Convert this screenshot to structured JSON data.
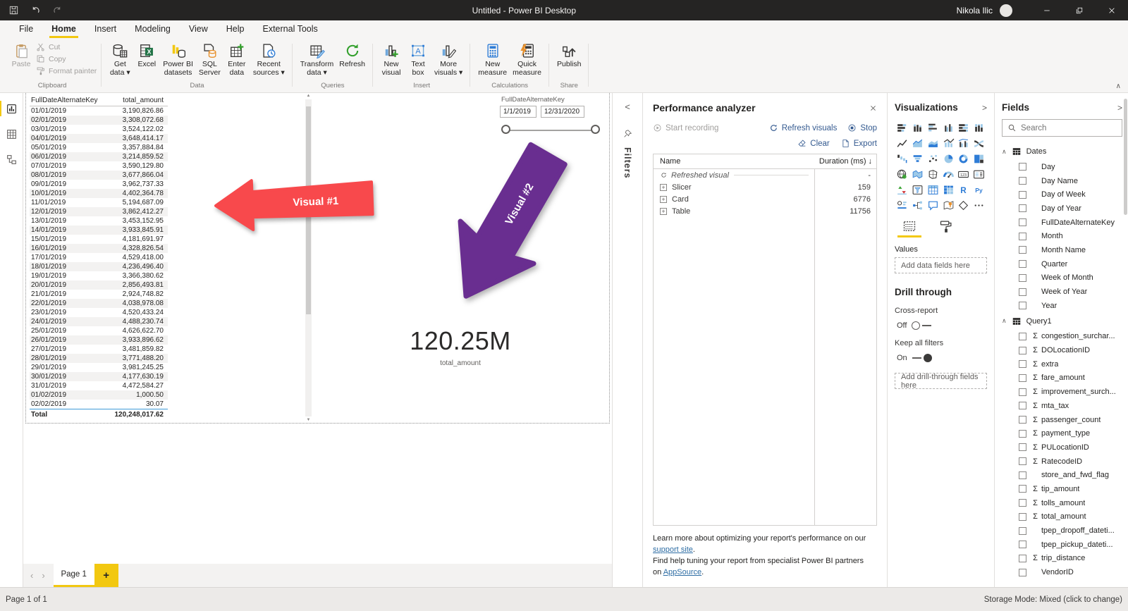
{
  "titlebar": {
    "title": "Untitled - Power BI Desktop",
    "user": "Nikola Ilic"
  },
  "menu": {
    "active": "Home",
    "items": [
      "File",
      "Home",
      "Insert",
      "Modeling",
      "View",
      "Help",
      "External Tools"
    ]
  },
  "ribbon": {
    "collapse_glyph": "∧",
    "groups": [
      {
        "label": "Clipboard",
        "big": [
          {
            "lines": [
              "Paste"
            ],
            "icon": "paste",
            "disabled": true
          }
        ],
        "stack": [
          {
            "label": "Cut",
            "icon": "cut"
          },
          {
            "label": "Copy",
            "icon": "copy"
          },
          {
            "label": "Format painter",
            "icon": "painter"
          }
        ]
      },
      {
        "label": "Data",
        "big": [
          {
            "lines": [
              "Get",
              "data"
            ],
            "icon": "getdata",
            "caret": true
          },
          {
            "lines": [
              "Excel"
            ],
            "icon": "excel"
          },
          {
            "lines": [
              "Power BI",
              "datasets"
            ],
            "icon": "pbidb"
          },
          {
            "lines": [
              "SQL",
              "Server"
            ],
            "icon": "sqldoc"
          },
          {
            "lines": [
              "Enter",
              "data"
            ],
            "icon": "entergrid"
          },
          {
            "lines": [
              "Recent",
              "sources"
            ],
            "icon": "recentdoc",
            "caret": true
          }
        ]
      },
      {
        "label": "Queries",
        "big": [
          {
            "lines": [
              "Transform",
              "data"
            ],
            "icon": "transform",
            "caret": true
          },
          {
            "lines": [
              "Refresh"
            ],
            "icon": "refreshG"
          }
        ]
      },
      {
        "label": "Insert",
        "big": [
          {
            "lines": [
              "New",
              "visual"
            ],
            "icon": "newvis"
          },
          {
            "lines": [
              "Text",
              "box"
            ],
            "icon": "textA"
          },
          {
            "lines": [
              "More",
              "visuals"
            ],
            "icon": "morevis",
            "caret": true
          }
        ]
      },
      {
        "label": "Calculations",
        "big": [
          {
            "lines": [
              "New",
              "measure"
            ],
            "icon": "calc"
          },
          {
            "lines": [
              "Quick",
              "measure"
            ],
            "icon": "quickcalc"
          }
        ]
      },
      {
        "label": "Share",
        "big": [
          {
            "lines": [
              "Publish"
            ],
            "icon": "publish"
          }
        ]
      }
    ]
  },
  "canvas": {
    "table": {
      "headers": [
        "FullDateAlternateKey",
        "total_amount"
      ],
      "rows": [
        [
          "01/01/2019",
          "3,190,826.86"
        ],
        [
          "02/01/2019",
          "3,308,072.68"
        ],
        [
          "03/01/2019",
          "3,524,122.02"
        ],
        [
          "04/01/2019",
          "3,648,414.17"
        ],
        [
          "05/01/2019",
          "3,357,884.84"
        ],
        [
          "06/01/2019",
          "3,214,859.52"
        ],
        [
          "07/01/2019",
          "3,590,129.80"
        ],
        [
          "08/01/2019",
          "3,677,866.04"
        ],
        [
          "09/01/2019",
          "3,962,737.33"
        ],
        [
          "10/01/2019",
          "4,402,364.78"
        ],
        [
          "11/01/2019",
          "5,194,687.09"
        ],
        [
          "12/01/2019",
          "3,862,412.27"
        ],
        [
          "13/01/2019",
          "3,453,152.95"
        ],
        [
          "14/01/2019",
          "3,933,845.91"
        ],
        [
          "15/01/2019",
          "4,181,691.97"
        ],
        [
          "16/01/2019",
          "4,328,826.54"
        ],
        [
          "17/01/2019",
          "4,529,418.00"
        ],
        [
          "18/01/2019",
          "4,236,496.40"
        ],
        [
          "19/01/2019",
          "3,366,380.62"
        ],
        [
          "20/01/2019",
          "2,856,493.81"
        ],
        [
          "21/01/2019",
          "2,924,748.82"
        ],
        [
          "22/01/2019",
          "4,038,978.08"
        ],
        [
          "23/01/2019",
          "4,520,433.24"
        ],
        [
          "24/01/2019",
          "4,488,230.74"
        ],
        [
          "25/01/2019",
          "4,626,622.70"
        ],
        [
          "26/01/2019",
          "3,933,896.62"
        ],
        [
          "27/01/2019",
          "3,481,859.82"
        ],
        [
          "28/01/2019",
          "3,771,488.20"
        ],
        [
          "29/01/2019",
          "3,981,245.25"
        ],
        [
          "30/01/2019",
          "4,177,630.19"
        ],
        [
          "31/01/2019",
          "4,472,584.27"
        ],
        [
          "01/02/2019",
          "1,000.50"
        ],
        [
          "02/02/2019",
          "30.07"
        ]
      ],
      "total": [
        "Total",
        "120,248,017.62"
      ]
    },
    "slicer": {
      "field": "FullDateAlternateKey",
      "start": "1/1/2019",
      "end": "12/31/2020"
    },
    "card": {
      "value": "120.25M",
      "label": "total_amount"
    },
    "arrow1": {
      "label": "Visual #1",
      "color": "#f8494c"
    },
    "arrow2": {
      "label": "Visual #2",
      "color": "#692e90"
    }
  },
  "filters": {
    "collapse_glyph": "<",
    "label": "Filters"
  },
  "perf": {
    "title": "Performance analyzer",
    "start_label": "Start recording",
    "refresh_label": "Refresh visuals",
    "stop_label": "Stop",
    "clear_label": "Clear",
    "export_label": "Export",
    "col_name": "Name",
    "col_duration": "Duration (ms)",
    "sort_glyph": "↓",
    "rows": [
      {
        "name": "Refreshed visual",
        "duration": "-",
        "type": "refresh"
      },
      {
        "name": "Slicer",
        "duration": "159",
        "type": "item"
      },
      {
        "name": "Card",
        "duration": "6776",
        "type": "item"
      },
      {
        "name": "Table",
        "duration": "11756",
        "type": "item"
      }
    ],
    "footer": {
      "l1a": "Learn more about optimizing your report's performance on our ",
      "l1link": "support site",
      "l1b": ".",
      "l2": "Find help tuning your report from specialist Power BI partners",
      "l3a": "on ",
      "l3link": "AppSource",
      "l3b": "."
    }
  },
  "viz": {
    "title": "Visualizations",
    "expand_glyph": ">",
    "icons": [
      {
        "name": "stacked-bar-chart",
        "kind": "sbarH"
      },
      {
        "name": "stacked-column-chart",
        "kind": "scolV"
      },
      {
        "name": "clustered-bar-chart",
        "kind": "cbarH"
      },
      {
        "name": "clustered-column-chart",
        "kind": "ccolV"
      },
      {
        "name": "100-stacked-bar-chart",
        "kind": "pbarH"
      },
      {
        "name": "100-stacked-column-chart",
        "kind": "pcolV"
      },
      {
        "name": "line-chart",
        "kind": "lineC"
      },
      {
        "name": "area-chart",
        "kind": "areaC"
      },
      {
        "name": "stacked-area-chart",
        "kind": "sareaC"
      },
      {
        "name": "line-and-stacked-column-chart",
        "kind": "lscol"
      },
      {
        "name": "line-and-clustered-column-chart",
        "kind": "lccol"
      },
      {
        "name": "ribbon-chart",
        "kind": "ribbonC"
      },
      {
        "name": "waterfall-chart",
        "kind": "waterC"
      },
      {
        "name": "funnel-chart",
        "kind": "funnelC"
      },
      {
        "name": "scatter-chart",
        "kind": "scatterC"
      },
      {
        "name": "pie-chart",
        "kind": "pieC"
      },
      {
        "name": "donut-chart",
        "kind": "donutC"
      },
      {
        "name": "treemap",
        "kind": "treemapC"
      },
      {
        "name": "map",
        "kind": "globeC"
      },
      {
        "name": "filled-map",
        "kind": "fmapC"
      },
      {
        "name": "shape-map",
        "kind": "smapC"
      },
      {
        "name": "gauge",
        "kind": "gaugeC"
      },
      {
        "name": "card",
        "kind": "c123"
      },
      {
        "name": "multi-row-card",
        "kind": "mcard"
      },
      {
        "name": "kpi",
        "kind": "kpiC"
      },
      {
        "name": "slicer",
        "kind": "slicerC"
      },
      {
        "name": "table",
        "kind": "tableC"
      },
      {
        "name": "matrix",
        "kind": "matrixC"
      },
      {
        "name": "r-script-visual",
        "kind": "rC"
      },
      {
        "name": "python-visual",
        "kind": "pyC"
      },
      {
        "name": "key-influencers",
        "kind": "kinfC"
      },
      {
        "name": "decomposition-tree",
        "kind": "dtreeC"
      },
      {
        "name": "q-and-a",
        "kind": "chatC"
      },
      {
        "name": "arcgis-map",
        "kind": "arcgisC"
      },
      {
        "name": "power-apps",
        "kind": "pappsC"
      },
      {
        "name": "more-visuals",
        "kind": "dotsC"
      }
    ],
    "values_label": "Values",
    "add_data": "Add data fields here",
    "drill_title": "Drill through",
    "cross_report": "Cross-report",
    "off_label": "Off",
    "keep_filters": "Keep all filters",
    "on_label": "On",
    "add_drill": "Add drill-through fields here"
  },
  "fields": {
    "title": "Fields",
    "expand_glyph": ">",
    "search_placeholder": "Search",
    "chevron_glyph": "∧",
    "sigma_glyph": "Σ",
    "groups": [
      {
        "name": "Dates",
        "items": [
          {
            "t": "Day"
          },
          {
            "t": "Day Name"
          },
          {
            "t": "Day of Week"
          },
          {
            "t": "Day of Year"
          },
          {
            "t": "FullDateAlternateKey"
          },
          {
            "t": "Month"
          },
          {
            "t": "Month Name"
          },
          {
            "t": "Quarter"
          },
          {
            "t": "Week of Month"
          },
          {
            "t": "Week of Year"
          },
          {
            "t": "Year"
          }
        ]
      },
      {
        "name": "Query1",
        "items": [
          {
            "t": "congestion_surchar...",
            "s": 1
          },
          {
            "t": "DOLocationID",
            "s": 1
          },
          {
            "t": "extra",
            "s": 1
          },
          {
            "t": "fare_amount",
            "s": 1
          },
          {
            "t": "improvement_surch...",
            "s": 1
          },
          {
            "t": "mta_tax",
            "s": 1
          },
          {
            "t": "passenger_count",
            "s": 1
          },
          {
            "t": "payment_type",
            "s": 1
          },
          {
            "t": "PULocationID",
            "s": 1
          },
          {
            "t": "RatecodeID",
            "s": 1
          },
          {
            "t": "store_and_fwd_flag"
          },
          {
            "t": "tip_amount",
            "s": 1
          },
          {
            "t": "tolls_amount",
            "s": 1
          },
          {
            "t": "total_amount",
            "s": 1
          },
          {
            "t": "tpep_dropoff_dateti..."
          },
          {
            "t": "tpep_pickup_dateti..."
          },
          {
            "t": "trip_distance",
            "s": 1
          },
          {
            "t": "VendorID"
          }
        ]
      }
    ]
  },
  "pages": {
    "prev_glyph": "‹",
    "next_glyph": "›",
    "tab": "Page 1",
    "add_glyph": "+"
  },
  "status": {
    "left": "Page 1 of 1",
    "right": "Storage Mode: Mixed (click to change)"
  },
  "colors": {
    "accent_yellow": "#f2c811",
    "titlebar": "#252423",
    "arrow_red": "#f8494c",
    "arrow_purple": "#692e90",
    "link_blue": "#2e6da4",
    "command_blue": "#33598f"
  }
}
